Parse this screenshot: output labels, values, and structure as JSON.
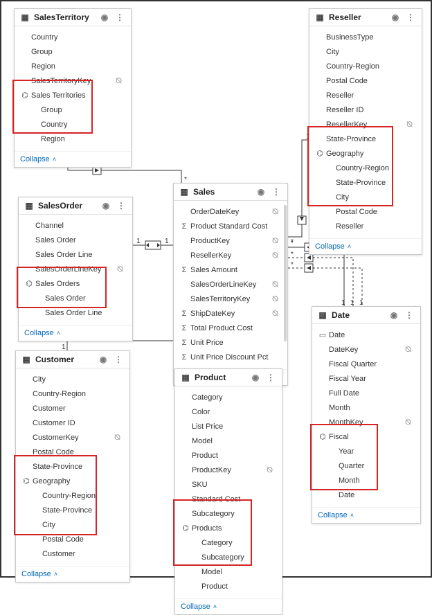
{
  "collapse_label": "Collapse",
  "icons": {
    "hidden": "hidden-eye-icon"
  },
  "tables": {
    "salesTerritory": {
      "title": "SalesTerritory",
      "fields": [
        {
          "label": "Country"
        },
        {
          "label": "Group"
        },
        {
          "label": "Region"
        },
        {
          "label": "SalesTerritoryKey",
          "hidden": true
        }
      ],
      "hierarchy": {
        "name": "Sales Territories",
        "levels": [
          "Group",
          "Country",
          "Region"
        ]
      }
    },
    "reseller": {
      "title": "Reseller",
      "fields": [
        {
          "label": "BusinessType"
        },
        {
          "label": "City"
        },
        {
          "label": "Country-Region"
        },
        {
          "label": "Postal Code"
        },
        {
          "label": "Reseller"
        },
        {
          "label": "Reseller ID"
        },
        {
          "label": "ResellerKey",
          "hidden": true
        },
        {
          "label": "State-Province"
        }
      ],
      "hierarchy": {
        "name": "Geography",
        "levels": [
          "Country-Region",
          "State-Province",
          "City",
          "Postal Code",
          "Reseller"
        ]
      }
    },
    "sales": {
      "title": "Sales",
      "fields": [
        {
          "label": "OrderDateKey",
          "hidden": true
        },
        {
          "label": "Product Standard Cost",
          "agg": "Σ"
        },
        {
          "label": "ProductKey",
          "hidden": true
        },
        {
          "label": "ResellerKey",
          "hidden": true
        },
        {
          "label": "Sales Amount",
          "agg": "Σ"
        },
        {
          "label": "SalesOrderLineKey",
          "hidden": true
        },
        {
          "label": "SalesTerritoryKey",
          "hidden": true
        },
        {
          "label": "ShipDateKey",
          "agg": "Σ",
          "hidden": true
        },
        {
          "label": "Total Product Cost",
          "agg": "Σ"
        },
        {
          "label": "Unit Price",
          "agg": "Σ"
        },
        {
          "label": "Unit Price Discount Pct",
          "agg": "Σ"
        }
      ]
    },
    "salesOrder": {
      "title": "SalesOrder",
      "fields": [
        {
          "label": "Channel"
        },
        {
          "label": "Sales Order"
        },
        {
          "label": "Sales Order Line"
        },
        {
          "label": "SalesOrderLineKey",
          "hidden": true
        }
      ],
      "hierarchy": {
        "name": "Sales Orders",
        "levels": [
          "Sales Order",
          "Sales Order Line"
        ]
      }
    },
    "customer": {
      "title": "Customer",
      "fields": [
        {
          "label": "City"
        },
        {
          "label": "Country-Region"
        },
        {
          "label": "Customer"
        },
        {
          "label": "Customer ID"
        },
        {
          "label": "CustomerKey",
          "hidden": true
        },
        {
          "label": "Postal Code"
        },
        {
          "label": "State-Province"
        }
      ],
      "hierarchy": {
        "name": "Geography",
        "levels": [
          "Country-Region",
          "State-Province",
          "City",
          "Postal Code",
          "Customer"
        ]
      }
    },
    "product": {
      "title": "Product",
      "fields": [
        {
          "label": "Category"
        },
        {
          "label": "Color"
        },
        {
          "label": "List Price"
        },
        {
          "label": "Model"
        },
        {
          "label": "Product"
        },
        {
          "label": "ProductKey",
          "hidden": true
        },
        {
          "label": "SKU"
        },
        {
          "label": "Standard Cost"
        },
        {
          "label": "Subcategory"
        }
      ],
      "hierarchy": {
        "name": "Products",
        "levels": [
          "Category",
          "Subcategory",
          "Model",
          "Product"
        ]
      }
    },
    "date": {
      "title": "Date",
      "fields": [
        {
          "label": "Date",
          "agg": "cal"
        },
        {
          "label": "DateKey",
          "hidden": true
        },
        {
          "label": "Fiscal Quarter"
        },
        {
          "label": "Fiscal Year"
        },
        {
          "label": "Full Date"
        },
        {
          "label": "Month"
        },
        {
          "label": "MonthKey",
          "hidden": true
        }
      ],
      "hierarchy": {
        "name": "Fiscal",
        "levels": [
          "Year",
          "Quarter",
          "Month",
          "Date"
        ]
      }
    }
  },
  "relationships": {
    "cardinality_one": "1",
    "cardinality_many": "*"
  }
}
